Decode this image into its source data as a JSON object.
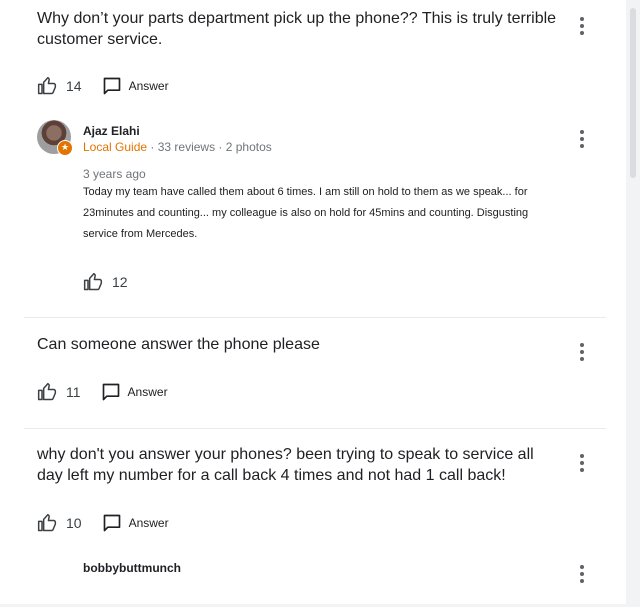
{
  "q1": {
    "text": "Why don’t your parts department pick up the phone?? This is truly terrible customer service.",
    "likes": "14",
    "answer_label": "Answer"
  },
  "a1": {
    "name": "Ajaz Elahi",
    "local_guide": "Local Guide",
    "sep1": " · ",
    "reviews": "33 reviews",
    "sep2": " · ",
    "photos": "2 photos",
    "time": "3 years ago",
    "text": "Today my team have called them about 6 times. I am still on hold to them as we speak... for 23minutes and counting... my colleague is also on hold for 45mins and counting. Disgusting service from Mercedes.",
    "likes": "12"
  },
  "q2": {
    "text": "Can someone answer the phone please",
    "likes": "11",
    "answer_label": "Answer"
  },
  "q3": {
    "text": "why don't you answer your phones? been trying to speak to service all day left my number for a call back 4 times and not had 1 call back!",
    "likes": "10",
    "answer_label": "Answer"
  },
  "a2": {
    "name": "bobbybuttmunch"
  },
  "colors": {
    "local_guide": "#e37400",
    "text": "#202124",
    "icon": "#3c4043"
  },
  "icons": {
    "like": "thumb-up-icon",
    "answer": "comment-icon",
    "more": "more-vert-icon",
    "guide_badge": "local-guide-badge-icon"
  }
}
